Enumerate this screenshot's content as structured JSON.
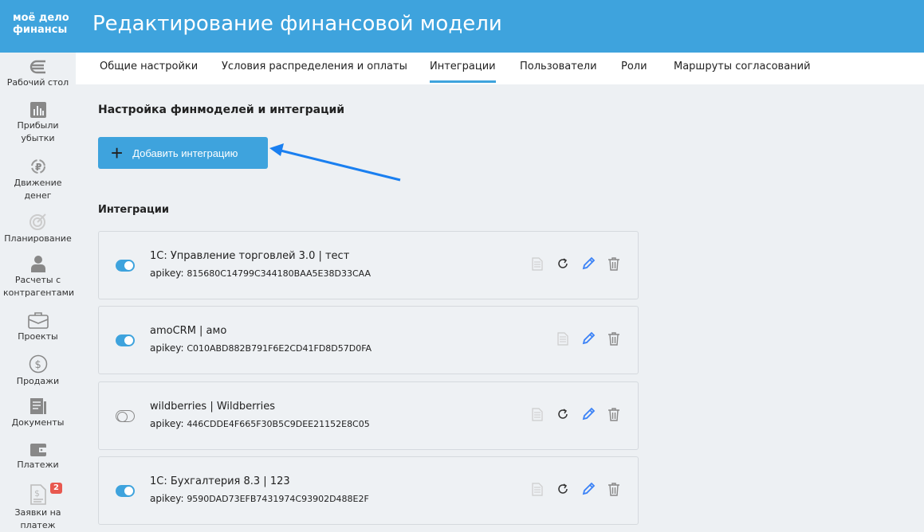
{
  "header": {
    "logo_line1": "моё дело",
    "logo_line2": "финансы",
    "title": "Редактирование финансовой модели"
  },
  "sidebar": {
    "items": [
      {
        "label": "Рабочий стол",
        "icon": "euro-icon"
      },
      {
        "label": "Прибыли убытки",
        "icon": "bar-chart-icon"
      },
      {
        "label": "Движение денег",
        "icon": "ruble-cycle-icon"
      },
      {
        "label": "Планирование",
        "icon": "target-icon"
      },
      {
        "label": "Расчеты с контрагентами",
        "icon": "person-icon"
      },
      {
        "label": "Проекты",
        "icon": "briefcase-icon"
      },
      {
        "label": "Продажи",
        "icon": "dollar-icon"
      },
      {
        "label": "Документы",
        "icon": "documents-icon"
      },
      {
        "label": "Платежи",
        "icon": "wallet-icon"
      },
      {
        "label": "Заявки на платеж",
        "icon": "invoice-icon",
        "badge": "2"
      }
    ]
  },
  "tabs": [
    {
      "label": "Общие настройки"
    },
    {
      "label": "Условия распределения и оплаты"
    },
    {
      "label": "Интеграции",
      "active": true
    },
    {
      "label": "Пользователи"
    },
    {
      "label": "Роли"
    },
    {
      "label": "Маршруты согласований"
    }
  ],
  "main": {
    "heading": "Настройка финмоделей и интеграций",
    "add_button": "Добавить интеграцию",
    "list_heading": "Интеграции",
    "apikey_label": "apikey:"
  },
  "integrations": [
    {
      "name": "1С: Управление торговлей 3.0 | тест",
      "apikey": "815680C14799C344180BAA5E38D33CAA",
      "enabled": true,
      "refresh": true
    },
    {
      "name": "amoCRM | амо",
      "apikey": "C010ABD882B791F6E2CD41FD8D57D0FA",
      "enabled": true,
      "refresh": false
    },
    {
      "name": "wildberries | Wildberries",
      "apikey": "446CDDE4F665F30B5C9DEE21152E8C05",
      "enabled": false,
      "refresh": true
    },
    {
      "name": "1С: Бухгалтерия 8.3 | 123",
      "apikey": "9590DAD73EFB7431974C93902D488E2F",
      "enabled": true,
      "refresh": true
    }
  ],
  "colors": {
    "brand": "#3ea3dd",
    "arrow": "#1a7ff0",
    "edit": "#3b82f6"
  }
}
